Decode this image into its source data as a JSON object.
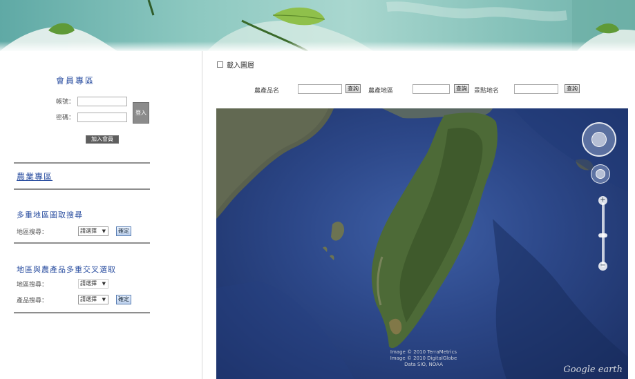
{
  "sidebar": {
    "member_title": "會員專區",
    "account_label": "帳號：",
    "password_label": "密碼：",
    "login_button": "登入",
    "register_button": "加入會員",
    "expert_link": "農業專區",
    "multi_query_title": "多重地區圖取搜尋",
    "multi_query_label": "地區搜尋：",
    "multi_query_select": "請選擇",
    "multi_query_button": "確定",
    "cross_title": "地區與農產品多重交叉選取",
    "area_label": "地區搜尋：",
    "area_select": "請選擇",
    "product_label": "產品搜尋：",
    "product_select": "請選擇",
    "cross_button": "確定"
  },
  "content": {
    "toggle_label": "載入圖層",
    "search_product_name": "農產品名",
    "search_product_area": "農產地區",
    "search_place": "景點地名",
    "search_button": "查詢"
  },
  "map": {
    "attribution_lines": [
      "Image © 2010 TerraMetrics",
      "Image © 2010 DigitalGlobe",
      "Data SIO, NOAA"
    ],
    "logo": "Google earth"
  }
}
